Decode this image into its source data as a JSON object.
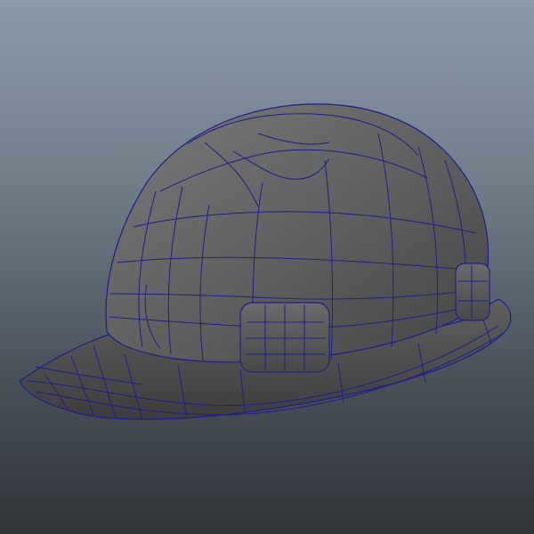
{
  "viewport": {
    "background_top": "#8b9aa8",
    "background_bottom": "#2f3438",
    "wireframe_color": "#1e1e8c",
    "shell_color": "#5f5f5f",
    "shell_highlight": "#7a7a7a",
    "shell_shadow": "#3f3f3f"
  },
  "model": {
    "name": "hard-hat-model",
    "display_mode": "shaded-wireframe"
  }
}
